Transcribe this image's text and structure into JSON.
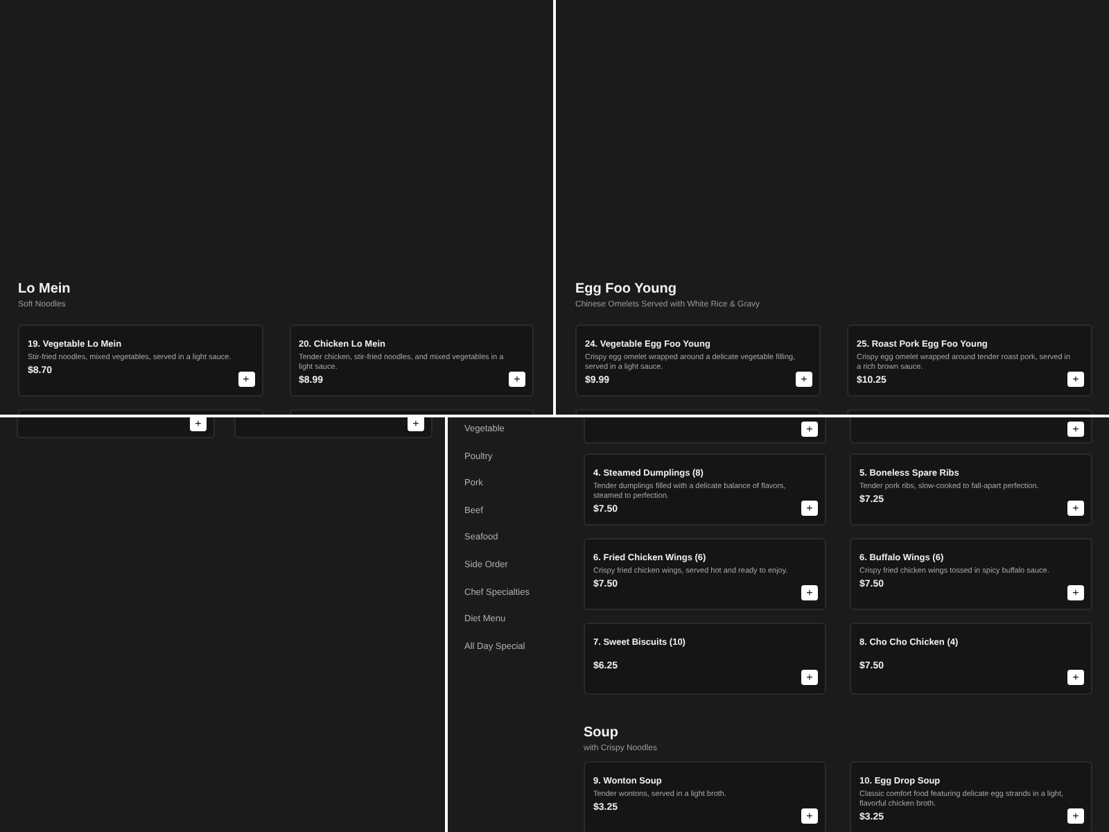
{
  "panels": [
    {
      "kind": "section",
      "title": "Lo Mein",
      "subtitle": "Soft Noodles",
      "items": [
        {
          "name": "19. Vegetable Lo Mein",
          "description": "Stir-fried noodles, mixed vegetables, served in a light sauce.",
          "price": "$8.70",
          "add_label": "+"
        },
        {
          "name": "20. Chicken Lo Mein",
          "description": "Tender chicken, stir-fried noodles, and mixed vegetables in a light sauce.",
          "price": "$8.99",
          "add_label": "+"
        }
      ]
    },
    {
      "kind": "section",
      "title": "Egg Foo Young",
      "subtitle": "Chinese Omelets Served with White Rice & Gravy",
      "items": [
        {
          "name": "24. Vegetable Egg Foo Young",
          "description": "Crispy egg omelet wrapped around a delicate vegetable filling, served in a light sauce.",
          "price": "$9.99",
          "add_label": "+"
        },
        {
          "name": "25. Roast Pork Egg Foo Young",
          "description": "Crispy egg omelet wrapped around tender roast pork, served in a rich brown sauce.",
          "price": "$10.25",
          "add_label": "+"
        }
      ]
    },
    {
      "kind": "fragment",
      "cut_items": [
        {
          "add_label": "+"
        },
        {
          "add_label": "+"
        }
      ]
    },
    {
      "kind": "menu",
      "sidebar": [
        "Vegetable",
        "Poultry",
        "Pork",
        "Beef",
        "Seafood",
        "Side Order",
        "Chef Specialties",
        "Diet Menu",
        "All Day Special"
      ],
      "cut_items": [
        {
          "add_label": "+"
        },
        {
          "add_label": "+"
        }
      ],
      "items": [
        {
          "name": "4. Steamed Dumplings (8)",
          "description": "Tender dumplings filled with a delicate balance of flavors, steamed to perfection.",
          "price": "$7.50",
          "add_label": "+"
        },
        {
          "name": "5. Boneless Spare Ribs",
          "description": "Tender pork ribs, slow-cooked to fall-apart perfection.",
          "price": "$7.25",
          "add_label": "+"
        },
        {
          "name": "6. Fried Chicken Wings (6)",
          "description": "Crispy fried chicken wings, served hot and ready to enjoy.",
          "price": "$7.50",
          "add_label": "+"
        },
        {
          "name": "6. Buffalo Wings (6)",
          "description": "Crispy fried chicken wings tossed in spicy buffalo sauce.",
          "price": "$7.50",
          "add_label": "+"
        },
        {
          "name": "7. Sweet Biscuits (10)",
          "price": "$6.25",
          "add_label": "+"
        },
        {
          "name": "8. Cho Cho Chicken (4)",
          "price": "$7.50",
          "add_label": "+"
        }
      ],
      "sections": [
        {
          "title": "Soup",
          "subtitle": "with Crispy Noodles",
          "items": [
            {
              "name": "9. Wonton Soup",
              "description": "Tender wontons, served in a light broth.",
              "price": "$3.25",
              "add_label": "+"
            },
            {
              "name": "10. Egg Drop Soup",
              "description": "Classic comfort food featuring delicate egg strands in a light, flavorful chicken broth.",
              "price": "$3.25",
              "add_label": "+"
            }
          ]
        }
      ]
    }
  ]
}
